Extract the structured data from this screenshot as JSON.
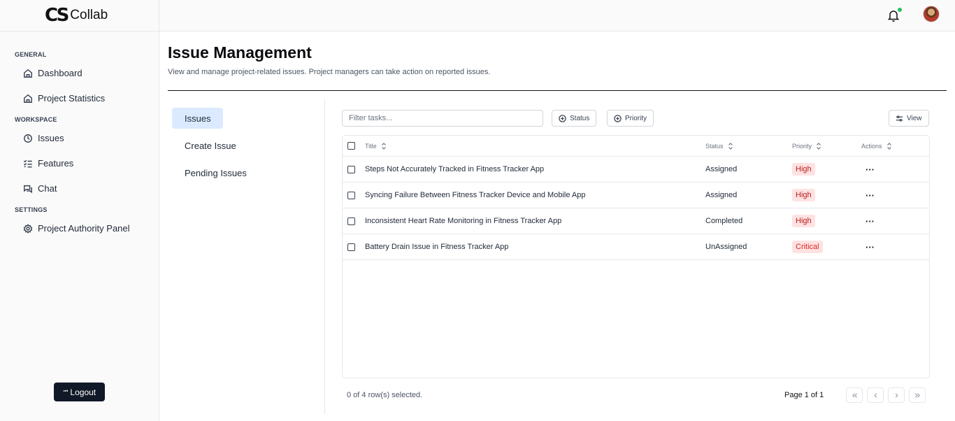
{
  "brand": {
    "logo": "CS",
    "name": "Collab"
  },
  "sidebar": {
    "sections": [
      {
        "label": "GENERAL",
        "items": [
          {
            "label": "Dashboard",
            "icon": "home-icon"
          },
          {
            "label": "Project Statistics",
            "icon": "home-icon"
          }
        ]
      },
      {
        "label": "WORKSPACE",
        "items": [
          {
            "label": "Issues",
            "icon": "clock-icon"
          },
          {
            "label": "Features",
            "icon": "checklist-icon"
          },
          {
            "label": "Chat",
            "icon": "chat-icon"
          }
        ]
      },
      {
        "label": "SETTINGS",
        "items": [
          {
            "label": "Project Authority Panel",
            "icon": "gear-icon"
          }
        ]
      }
    ],
    "logout_label": "Logout"
  },
  "topbar": {
    "notification_icon": "bell-icon",
    "notification_dot_color": "#22c55e"
  },
  "header": {
    "title": "Issue Management",
    "subtitle": "View and manage project-related issues. Project managers can take action on reported issues."
  },
  "subnav": {
    "items": [
      "Issues",
      "Create Issue",
      "Pending Issues"
    ],
    "active": "Issues"
  },
  "toolbar": {
    "filter_placeholder": "Filter tasks...",
    "status_label": "Status",
    "priority_label": "Priority",
    "view_label": "View"
  },
  "table": {
    "columns": [
      "Title",
      "Status",
      "Priority",
      "Actions"
    ],
    "rows": [
      {
        "title": "Steps Not Accurately Tracked in Fitness Tracker App",
        "status": "Assigned",
        "priority": "High",
        "actions": "···"
      },
      {
        "title": "Syncing Failure Between Fitness Tracker Device and Mobile App",
        "status": "Assigned",
        "priority": "High",
        "actions": "···"
      },
      {
        "title": "Inconsistent Heart Rate Monitoring in Fitness Tracker App",
        "status": "Completed",
        "priority": "High",
        "actions": "···"
      },
      {
        "title": "Battery Drain Issue in Fitness Tracker App",
        "status": "UnAssigned",
        "priority": "Critical",
        "actions": "···"
      }
    ],
    "badge_colors": {
      "High": {
        "bg": "#fee2e2",
        "fg": "#b91c1c"
      },
      "Critical": {
        "bg": "#fee2e2",
        "fg": "#dc2626"
      }
    }
  },
  "footer": {
    "selection_text": "0 of 4 row(s) selected.",
    "page_text": "Page 1 of 1"
  }
}
